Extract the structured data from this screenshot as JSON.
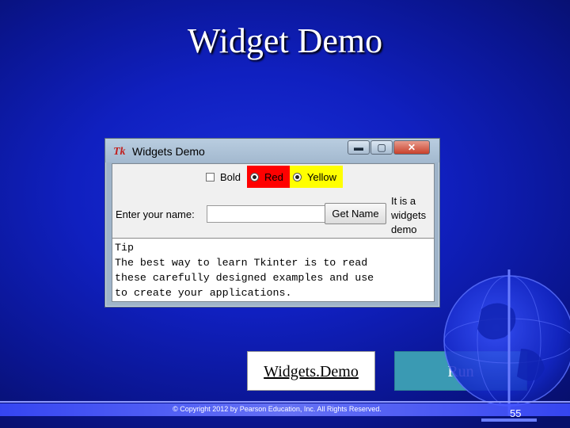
{
  "slide": {
    "title": "Widget Demo",
    "copyright": "© Copyright 2012 by Pearson Education, Inc. All Rights Reserved.",
    "page_number": "55"
  },
  "window": {
    "icon_label": "Tk",
    "title": "Widgets Demo",
    "controls": {
      "minimize": "▬",
      "maximize": "▢",
      "close": "✕"
    },
    "options": [
      {
        "label": "Bold",
        "kind": "checkbox",
        "checked": false
      },
      {
        "label": "Red",
        "kind": "radio",
        "background": "#ff0000"
      },
      {
        "label": "Yellow",
        "kind": "radio",
        "background": "#ffff00"
      }
    ],
    "name_label": "Enter your name:",
    "name_value": "",
    "get_name_button": "Get Name",
    "message_lines": [
      "It is a",
      "widgets",
      "demo"
    ],
    "text_lines": [
      "Tip",
      "The best way to learn Tkinter is to read",
      "these carefully designed examples and use",
      "to create your applications."
    ]
  },
  "actions": {
    "link_label": "Widgets.Demo",
    "run_label": "Run"
  },
  "colors": {
    "background": "#1020c0",
    "run_button": "#3a9ab3"
  }
}
